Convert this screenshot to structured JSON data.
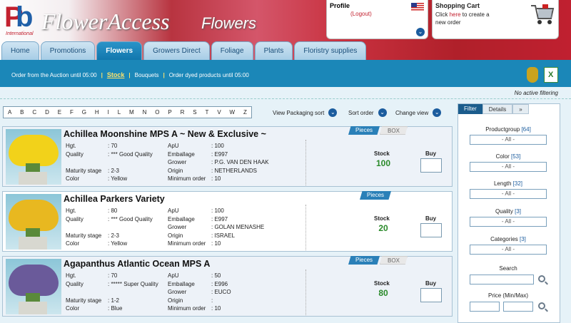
{
  "brand": {
    "logo_letters_1": "P",
    "logo_letters_2": "b",
    "logo_sub": "International",
    "name": "FlowerAccess",
    "sub": "Flowers"
  },
  "profile": {
    "title": "Profile",
    "logout": "(Logout)"
  },
  "cart": {
    "title": "Shopping Cart",
    "text_pre": "Click ",
    "link": "here",
    "text_post": " to create a new order"
  },
  "tabs": [
    {
      "label": "Home"
    },
    {
      "label": "Promotions"
    },
    {
      "label": "Flowers"
    },
    {
      "label": "Growers Direct"
    },
    {
      "label": "Foliage"
    },
    {
      "label": "Plants"
    },
    {
      "label": "Floristry supplies"
    }
  ],
  "subnav": {
    "order_auction": "Order from the Auction until 05:00",
    "stock": "Stock",
    "bouquets": "Bouquets",
    "dyed": "Order dyed products until 05:00",
    "sep": "|"
  },
  "no_filter": "No active filtering",
  "alphabet": [
    "A",
    "B",
    "C",
    "D",
    "E",
    "F",
    "G",
    "H",
    "I",
    "L",
    "M",
    "N",
    "O",
    "P",
    "R",
    "S",
    "T",
    "V",
    "W",
    "Z"
  ],
  "options": {
    "packaging": "View Packaging sort",
    "sort": "Sort order",
    "change": "Change view"
  },
  "labels": {
    "hgt": "Hgt.",
    "quality": "Quality",
    "maturity": "Maturity stage",
    "color": "Color",
    "apu": "ApU",
    "emballage": "Emballage",
    "grower": "Grower",
    "origin": "Origin",
    "minorder": "Minimum order",
    "stock": "Stock",
    "buy": "Buy",
    "pieces": "Pieces",
    "box": "BOX"
  },
  "products": [
    {
      "name": "Achillea Moonshine MPS A ~ New & Exclusive ~",
      "hgt": ": 70",
      "quality": ": *** Good Quality",
      "maturity": ": 2-3",
      "color": ": Yellow",
      "apu": ": 100",
      "emballage": ": E997",
      "grower": ": P.G. VAN DEN HAAK",
      "origin": ": NETHERLANDS",
      "minorder": ": 10",
      "stock": "100"
    },
    {
      "name": "Achillea Parkers Variety",
      "hgt": ": 80",
      "quality": ": *** Good Quality",
      "maturity": ": 2-3",
      "color": ": Yellow",
      "apu": ": 100",
      "emballage": ": E997",
      "grower": ": GOLAN MENASHE",
      "origin": ": ISRAEL",
      "minorder": ": 10",
      "stock": "20"
    },
    {
      "name": "Agapanthus Atlantic Ocean MPS A",
      "hgt": ": 70",
      "quality": ": ***** Super Quality",
      "maturity": ": 1-2",
      "color": ": Blue",
      "apu": ": 50",
      "emballage": ": E996",
      "grower": ": EUCO",
      "origin": ":",
      "minorder": ": 10",
      "stock": "80"
    }
  ],
  "filter": {
    "tab_filter": "Filter",
    "tab_details": "Details",
    "tab_more": "»",
    "groups": [
      {
        "label": "Productgroup",
        "count": "[64]",
        "value": "- All -"
      },
      {
        "label": "Color",
        "count": "[53]",
        "value": "- All -"
      },
      {
        "label": "Length",
        "count": "[32]",
        "value": "- All -"
      },
      {
        "label": "Quality",
        "count": "[3]",
        "value": "- All -"
      },
      {
        "label": "Categories",
        "count": "[3]",
        "value": "- All -"
      }
    ],
    "search": "Search",
    "price": "Price (Min/Max)"
  }
}
